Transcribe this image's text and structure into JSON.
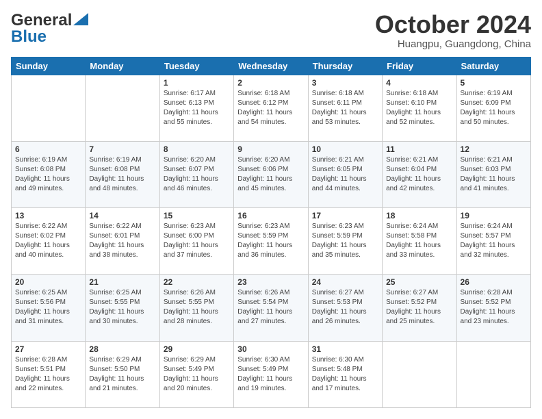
{
  "logo": {
    "text1": "General",
    "text2": "Blue"
  },
  "header": {
    "month": "October 2024",
    "location": "Huangpu, Guangdong, China"
  },
  "days_of_week": [
    "Sunday",
    "Monday",
    "Tuesday",
    "Wednesday",
    "Thursday",
    "Friday",
    "Saturday"
  ],
  "weeks": [
    [
      null,
      null,
      {
        "day": 1,
        "sunrise": "6:17 AM",
        "sunset": "6:13 PM",
        "daylight": "11 hours and 55 minutes."
      },
      {
        "day": 2,
        "sunrise": "6:18 AM",
        "sunset": "6:12 PM",
        "daylight": "11 hours and 54 minutes."
      },
      {
        "day": 3,
        "sunrise": "6:18 AM",
        "sunset": "6:11 PM",
        "daylight": "11 hours and 53 minutes."
      },
      {
        "day": 4,
        "sunrise": "6:18 AM",
        "sunset": "6:10 PM",
        "daylight": "11 hours and 52 minutes."
      },
      {
        "day": 5,
        "sunrise": "6:19 AM",
        "sunset": "6:09 PM",
        "daylight": "11 hours and 50 minutes."
      }
    ],
    [
      {
        "day": 6,
        "sunrise": "6:19 AM",
        "sunset": "6:08 PM",
        "daylight": "11 hours and 49 minutes."
      },
      {
        "day": 7,
        "sunrise": "6:19 AM",
        "sunset": "6:08 PM",
        "daylight": "11 hours and 48 minutes."
      },
      {
        "day": 8,
        "sunrise": "6:20 AM",
        "sunset": "6:07 PM",
        "daylight": "11 hours and 46 minutes."
      },
      {
        "day": 9,
        "sunrise": "6:20 AM",
        "sunset": "6:06 PM",
        "daylight": "11 hours and 45 minutes."
      },
      {
        "day": 10,
        "sunrise": "6:21 AM",
        "sunset": "6:05 PM",
        "daylight": "11 hours and 44 minutes."
      },
      {
        "day": 11,
        "sunrise": "6:21 AM",
        "sunset": "6:04 PM",
        "daylight": "11 hours and 42 minutes."
      },
      {
        "day": 12,
        "sunrise": "6:21 AM",
        "sunset": "6:03 PM",
        "daylight": "11 hours and 41 minutes."
      }
    ],
    [
      {
        "day": 13,
        "sunrise": "6:22 AM",
        "sunset": "6:02 PM",
        "daylight": "11 hours and 40 minutes."
      },
      {
        "day": 14,
        "sunrise": "6:22 AM",
        "sunset": "6:01 PM",
        "daylight": "11 hours and 38 minutes."
      },
      {
        "day": 15,
        "sunrise": "6:23 AM",
        "sunset": "6:00 PM",
        "daylight": "11 hours and 37 minutes."
      },
      {
        "day": 16,
        "sunrise": "6:23 AM",
        "sunset": "5:59 PM",
        "daylight": "11 hours and 36 minutes."
      },
      {
        "day": 17,
        "sunrise": "6:23 AM",
        "sunset": "5:59 PM",
        "daylight": "11 hours and 35 minutes."
      },
      {
        "day": 18,
        "sunrise": "6:24 AM",
        "sunset": "5:58 PM",
        "daylight": "11 hours and 33 minutes."
      },
      {
        "day": 19,
        "sunrise": "6:24 AM",
        "sunset": "5:57 PM",
        "daylight": "11 hours and 32 minutes."
      }
    ],
    [
      {
        "day": 20,
        "sunrise": "6:25 AM",
        "sunset": "5:56 PM",
        "daylight": "11 hours and 31 minutes."
      },
      {
        "day": 21,
        "sunrise": "6:25 AM",
        "sunset": "5:55 PM",
        "daylight": "11 hours and 30 minutes."
      },
      {
        "day": 22,
        "sunrise": "6:26 AM",
        "sunset": "5:55 PM",
        "daylight": "11 hours and 28 minutes."
      },
      {
        "day": 23,
        "sunrise": "6:26 AM",
        "sunset": "5:54 PM",
        "daylight": "11 hours and 27 minutes."
      },
      {
        "day": 24,
        "sunrise": "6:27 AM",
        "sunset": "5:53 PM",
        "daylight": "11 hours and 26 minutes."
      },
      {
        "day": 25,
        "sunrise": "6:27 AM",
        "sunset": "5:52 PM",
        "daylight": "11 hours and 25 minutes."
      },
      {
        "day": 26,
        "sunrise": "6:28 AM",
        "sunset": "5:52 PM",
        "daylight": "11 hours and 23 minutes."
      }
    ],
    [
      {
        "day": 27,
        "sunrise": "6:28 AM",
        "sunset": "5:51 PM",
        "daylight": "11 hours and 22 minutes."
      },
      {
        "day": 28,
        "sunrise": "6:29 AM",
        "sunset": "5:50 PM",
        "daylight": "11 hours and 21 minutes."
      },
      {
        "day": 29,
        "sunrise": "6:29 AM",
        "sunset": "5:49 PM",
        "daylight": "11 hours and 20 minutes."
      },
      {
        "day": 30,
        "sunrise": "6:30 AM",
        "sunset": "5:49 PM",
        "daylight": "11 hours and 19 minutes."
      },
      {
        "day": 31,
        "sunrise": "6:30 AM",
        "sunset": "5:48 PM",
        "daylight": "11 hours and 17 minutes."
      },
      null,
      null
    ]
  ]
}
